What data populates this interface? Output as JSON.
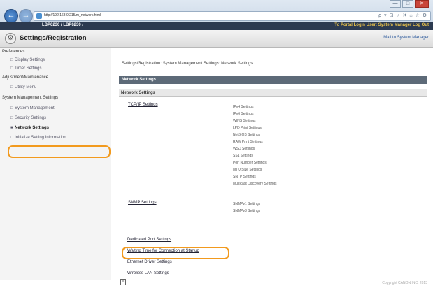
{
  "browser": {
    "url": "http://192.168.0.215/m_network.html",
    "tools": "ρ ▾ ⊡ ♂ ✕   ⌂ ☆ ⚙",
    "window_controls": [
      "—",
      "□",
      "✕"
    ]
  },
  "header": {
    "title": "LBP6230 / LBP6230 /",
    "links": "To Portal   Login User: System Manager   Log Out"
  },
  "appbar": {
    "title": "Settings/Registration",
    "mail_link": "Mail to System Manager"
  },
  "sidebar": {
    "preferences": "Preferences",
    "display": "Display Settings",
    "timer": "Timer Settings",
    "adjustment": "Adjustment/Maintenance",
    "utility": "Utility Menu",
    "system_mgmt": "System Management Settings",
    "system_management": "System Management",
    "security": "Security Settings",
    "network": "Network Settings",
    "initialize": "Initialize Setting Information"
  },
  "main": {
    "breadcrumb": "Settings/Registration: System Management Settings: Network Settings",
    "bar_title": "Network Settings",
    "section_title": "Network Settings",
    "tcpip": "TCP/IP Settings",
    "tcpip_items": [
      "IPv4 Settings",
      "IPv6 Settings",
      "WINS Settings",
      "LPD Print Settings",
      "NetBIOS Settings",
      "RAW Print Settings",
      "WSD Settings",
      "SSL Settings",
      "Port Number Settings",
      "MTU Size Settings",
      "SNTP Settings",
      "Multicast Discovery Settings"
    ],
    "snmp": "SNMP Settings",
    "snmp_items": [
      "SNMPv1 Settings",
      "SNMPv3 Settings"
    ],
    "dedicated_port": "Dedicated Port Settings",
    "waiting_time": "Waiting Time for Connection at Startup",
    "ethernet": "Ethernet Driver Settings",
    "wireless": "Wireless LAN Settings"
  },
  "footer": {
    "copyright": "Copyright CANON INC. 2013"
  }
}
